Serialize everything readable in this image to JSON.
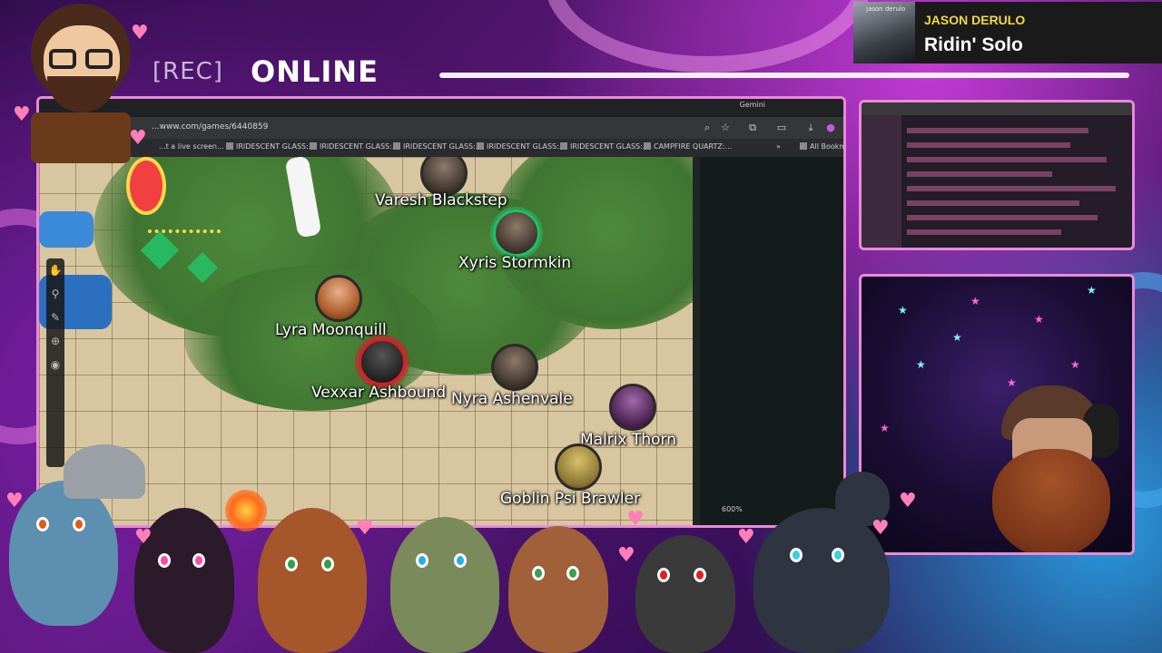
{
  "overlay": {
    "rec_label": "[REC]",
    "status": "ONLINE"
  },
  "now_playing": {
    "art_caption": "jason derulo",
    "artist": "JASON DERULO",
    "song": "Ridin' Solo"
  },
  "browser": {
    "gemini_label": "Gemini",
    "url": "...www.com/games/6440859",
    "bookmarks": [
      "...t a live screen...",
      "IRIDESCENT GLASS:...",
      "IRIDESCENT GLASS:...",
      "IRIDESCENT GLASS:...",
      "IRIDESCENT GLASS:...",
      "IRIDESCENT GLASS:...",
      "CAMPFIRE QUARTZ:..."
    ],
    "more_label": "»",
    "all_bookmarks": "All Bookm"
  },
  "vtt": {
    "zoom": "600%",
    "tokens": [
      {
        "name": "Varesh Blackstep",
        "ring": "none"
      },
      {
        "name": "Xyris Stormkin",
        "ring": "green"
      },
      {
        "name": "Lyra Moonquill",
        "ring": "none"
      },
      {
        "name": "Vexxar Ashbound",
        "ring": "red"
      },
      {
        "name": "Nyra Ashenvale",
        "ring": "none"
      },
      {
        "name": "Malrix Thorn",
        "ring": "none"
      },
      {
        "name": "Goblin Psi Brawler",
        "ring": "none"
      }
    ]
  },
  "colors": {
    "accent_pink": "#e98ad9",
    "artist_yellow": "#f1d84a",
    "green_ring": "#20c06a",
    "red_ring": "#d81e2a"
  },
  "icons": {
    "toolbar": [
      "search-icon",
      "star-icon",
      "extension-icon",
      "cast-icon",
      "download-icon",
      "profile-icon"
    ],
    "tools": [
      "hand-icon",
      "measure-icon",
      "pencil-icon",
      "target-icon",
      "user-icon"
    ]
  }
}
